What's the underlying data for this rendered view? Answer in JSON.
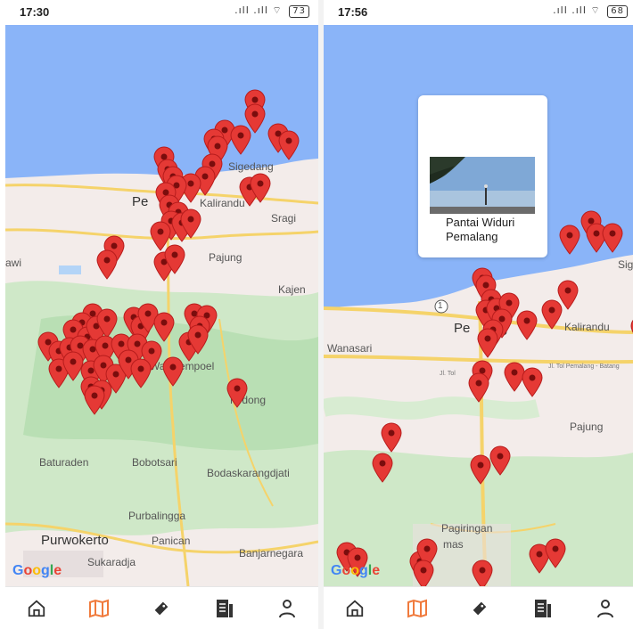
{
  "left_screen": {
    "time": "17:30",
    "signal": ".ıll .ıll",
    "battery": "73",
    "places": {
      "sigedang": "Sigedang",
      "pemalang": "Pe",
      "kalirandu": "Kalirandu",
      "sragi": "Sragi",
      "wawi": "awi",
      "pajung": "Pajung",
      "kajen": "Kajen",
      "watukempoel": "Wa   Krempoel",
      "mdong": "M   dong",
      "baturaden": "Baturaden",
      "bobotsari": "Bobotsari",
      "bodaskarangdjati": "Bodaskarangdjati",
      "purbalingga": "Purbalingga",
      "purwokerto": "Purwokerto",
      "panican": "Panican",
      "sukaradja": "Sukaradja",
      "banjarnegara": "Banjarnegara"
    },
    "google": [
      "G",
      "o",
      "o",
      "g",
      "l",
      "e"
    ]
  },
  "right_screen": {
    "time": "17:56",
    "signal": ".ıll .ıll",
    "battery": "68",
    "popup": {
      "name": "Pantai Widuri Pemalang"
    },
    "places": {
      "sig": "Sig",
      "wanasari": "Wanasari",
      "pemalang": "Pe",
      "pemalang2": "g",
      "kalirandu": "Kalirandu",
      "toll1": "Jl. Tol",
      "toll2": "Jl. Tol Pemalang - Batang",
      "pajung": "Pajung",
      "pagiringan": "Pagiringan",
      "mas": "mas",
      "route": "1"
    },
    "google": [
      "G",
      "o",
      "o",
      "g",
      "l",
      "e"
    ]
  },
  "nav": {
    "items": [
      "home-icon",
      "map-icon",
      "ticket-icon",
      "news-icon",
      "profile-icon"
    ],
    "active_color": "#f07a3c",
    "inactive_color": "#333333"
  },
  "colors": {
    "sea": "#8ab4f8",
    "land": "#f4ecec",
    "green": "#c8e6c9",
    "road": "#f5d36a",
    "pin": "#e53935"
  }
}
